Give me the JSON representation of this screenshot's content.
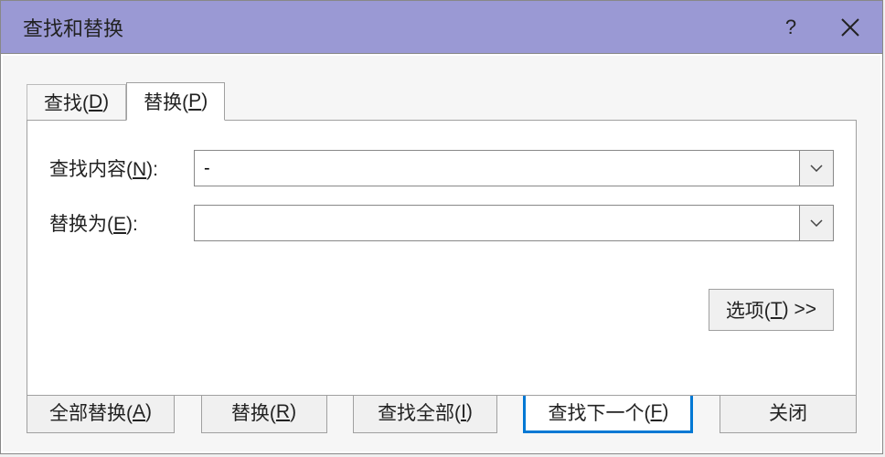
{
  "titlebar": {
    "title": "查找和替换",
    "help_symbol": "?",
    "close_label": "Close"
  },
  "tabs": {
    "find": {
      "text_prefix": "查找(",
      "hotkey": "D",
      "text_suffix": ")"
    },
    "replace": {
      "text_prefix": "替换(",
      "hotkey": "P",
      "text_suffix": ")"
    }
  },
  "form": {
    "find_label": {
      "prefix": "查找内容(",
      "hotkey": "N",
      "suffix": "):"
    },
    "find_value": "-",
    "replace_label": {
      "prefix": "替换为(",
      "hotkey": "E",
      "suffix": "):"
    },
    "replace_value": ""
  },
  "options_button": {
    "prefix": "选项(",
    "hotkey": "T",
    "suffix": ") >>"
  },
  "buttons": {
    "replace_all": {
      "prefix": "全部替换(",
      "hotkey": "A",
      "suffix": ")"
    },
    "replace": {
      "prefix": "替换(",
      "hotkey": "R",
      "suffix": ")"
    },
    "find_all": {
      "prefix": "查找全部(",
      "hotkey": "I",
      "suffix": ")"
    },
    "find_next": {
      "prefix": "查找下一个(",
      "hotkey": "F",
      "suffix": ")"
    },
    "close": {
      "label": "关闭"
    }
  }
}
